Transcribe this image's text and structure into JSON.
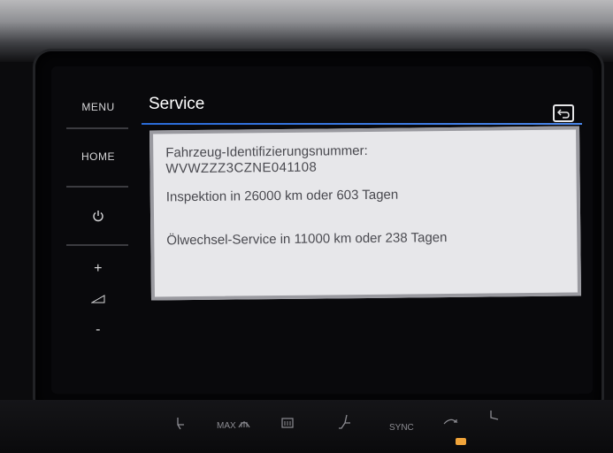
{
  "hardware_keys": {
    "menu": "MENU",
    "home": "HOME",
    "volume_up": "+",
    "volume_down": "-"
  },
  "header": {
    "title": "Service"
  },
  "service_info": {
    "vin_label": "Fahrzeug-Identifizierungsnummer:",
    "vin_value": "WVWZZZ3CZNE041108",
    "inspection": "Inspektion in 26000 km oder 603 Tagen",
    "oil_service": "Ölwechsel-Service in 11000 km oder 238 Tagen"
  },
  "climate_bar": {
    "max_label": "MAX",
    "sync_label": "SYNC"
  },
  "colors": {
    "accent_line": "#2a6bd8",
    "panel_bg": "#e7e7ea",
    "indicator": "#f0a43a"
  },
  "icons": [
    "power-icon",
    "volume-icon",
    "back-icon",
    "seat-heat-icon",
    "rear-defrost-icon",
    "seat-icon",
    "recirculation-icon",
    "fan-icon"
  ]
}
